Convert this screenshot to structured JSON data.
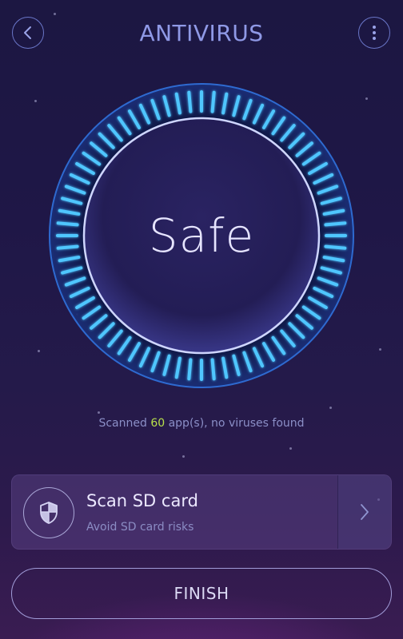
{
  "header": {
    "title": "ANTIVIRUS",
    "back_icon": "chevron-left-icon",
    "menu_icon": "more-vertical-icon"
  },
  "status": {
    "label": "Safe"
  },
  "scan_result": {
    "prefix": "Scanned ",
    "count": "60",
    "suffix": " app(s), no viruses found"
  },
  "sd_card": {
    "title": "Scan SD card",
    "subtitle": "Avoid SD card risks",
    "icon": "shield-icon",
    "arrow_icon": "chevron-right-icon"
  },
  "finish_button": {
    "label": "FINISH"
  },
  "colors": {
    "accent": "#8f99e6",
    "count_highlight": "#b7e04a",
    "dial_glow": "#4fc6ff"
  }
}
